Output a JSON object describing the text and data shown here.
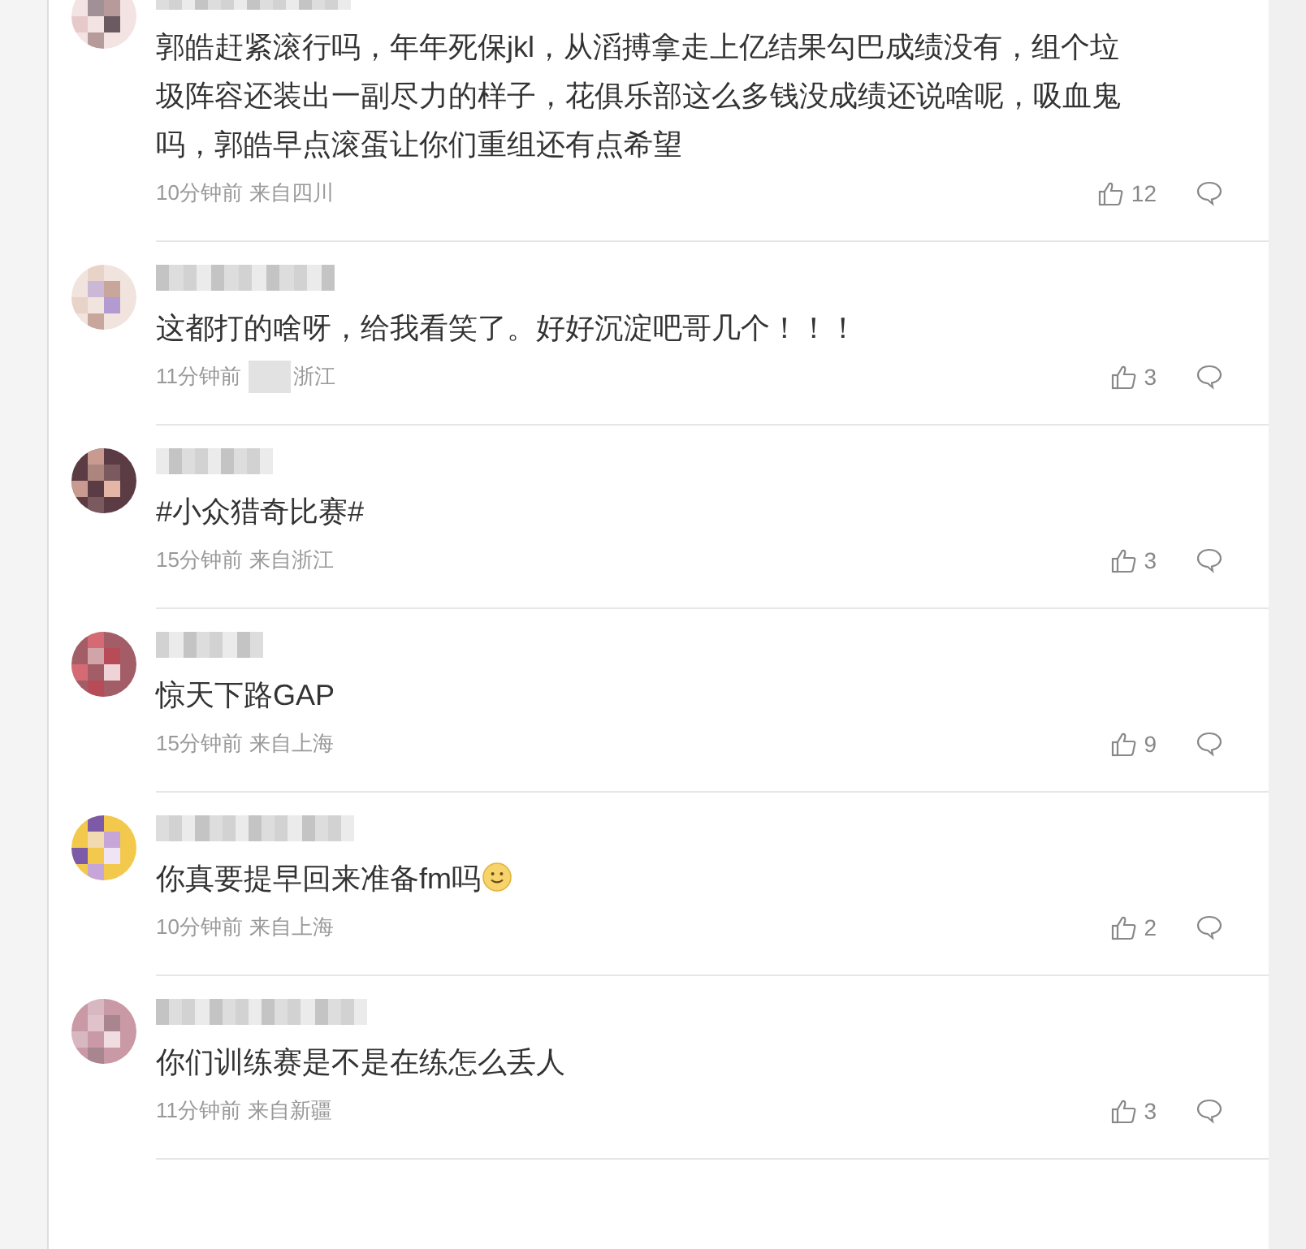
{
  "comments": [
    {
      "text": "郭皓赶紧滚行吗，年年死保jkl，从滔搏拿走上亿结果勾巴成绩没有，组个垃圾阵容还装出一副尽力的样子，花俱乐部这么多钱没成绩还说啥呢，吸血鬼吗，郭皓早点滚蛋让你们重组还有点希望",
      "emoji": false,
      "time": "10分钟前",
      "source": "来自四川",
      "source_partly_hidden": false,
      "likes": "12"
    },
    {
      "text": "这都打的啥呀，给我看笑了。好好沉淀吧哥几个！！！",
      "emoji": false,
      "time": "11分钟前",
      "source": "浙江",
      "source_partly_hidden": true,
      "likes": "3"
    },
    {
      "text": "#小众猎奇比赛#",
      "emoji": false,
      "time": "15分钟前",
      "source": "来自浙江",
      "source_partly_hidden": false,
      "likes": "3"
    },
    {
      "text": "惊天下路GAP",
      "emoji": false,
      "time": "15分钟前",
      "source": "来自上海",
      "source_partly_hidden": false,
      "likes": "9"
    },
    {
      "text": "你真要提早回来准备fm吗",
      "emoji": true,
      "time": "10分钟前",
      "source": "来自上海",
      "source_partly_hidden": false,
      "likes": "2"
    },
    {
      "text": "你们训练赛是不是在练怎么丢人",
      "emoji": false,
      "time": "11分钟前",
      "source": "来自新疆",
      "source_partly_hidden": false,
      "likes": "3"
    }
  ]
}
